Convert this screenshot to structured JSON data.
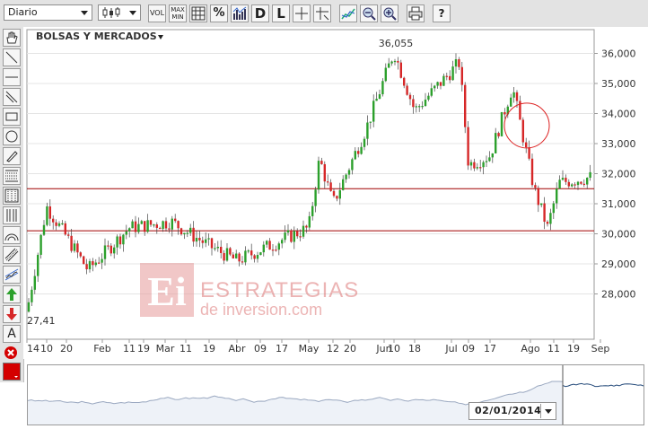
{
  "toolbar": {
    "period_select": "Diario",
    "chart_type_select": "candlestick",
    "buttons": {
      "vol": "VOL",
      "maxmin_top": "MAX",
      "maxmin_bottom": "MIN",
      "percent": "%",
      "daily": "D",
      "log": "L"
    },
    "icons": [
      "vol-icon",
      "maxmin-icon",
      "grid-icon",
      "percent-icon",
      "bar-volume-icon",
      "daily-icon",
      "log-icon",
      "crosshair-icon",
      "crosshair-cross-icon",
      "compare-icon",
      "zoom-out-icon",
      "zoom-in-icon",
      "print-icon",
      "help-icon"
    ]
  },
  "left_tools": {
    "icons": [
      "hand-icon",
      "line-icon",
      "horizontal-line-icon",
      "trendline-icon",
      "rectangle-icon",
      "circle-icon",
      "pencil-icon",
      "fibonacci-icon",
      "fibonacci-fan-icon",
      "vertical-lines-icon",
      "arc-icon",
      "parallel-channel-icon",
      "regression-icon",
      "buy-arrow-icon",
      "sell-arrow-icon",
      "text-icon",
      "delete-icon",
      "color-picker-icon"
    ],
    "text_tool_label": "A",
    "color": "#d40000"
  },
  "chart": {
    "title": "BOLSAS Y MERCADOS",
    "max_label": "36,055",
    "min_label": "27,41",
    "watermark_brand": "Ei",
    "watermark_line1": "ESTRATEGIAS",
    "watermark_line2": "de inversion.com",
    "colors": {
      "up": "#2ca02c",
      "down": "#d62728",
      "support": "#a00000"
    },
    "support_levels": [
      31500,
      30100
    ],
    "circle_annotation": {
      "x": "Jul 30",
      "y": 33600
    }
  },
  "chart_data": {
    "type": "candlestick",
    "y_axis_ticks": [
      "36,000",
      "35,000",
      "34,000",
      "33,000",
      "32,000",
      "31,000",
      "30,000",
      "29,000",
      "28,000"
    ],
    "ylim": [
      27000,
      36500
    ],
    "x_axis_labels": [
      "14",
      "10",
      "20",
      "Feb",
      "11",
      "19",
      "Mar",
      "11",
      "19",
      "Abr",
      "09",
      "17",
      "May",
      "12",
      "20",
      "Jun",
      "10",
      "18",
      "Jul",
      "09",
      "17",
      "Ago",
      "11",
      "19",
      "Sep"
    ],
    "points": [
      {
        "x": "Ene 14",
        "close": 27410
      },
      {
        "x": "Ene 20",
        "close": 30900
      },
      {
        "x": "Feb",
        "close": 28800
      },
      {
        "x": "Feb 19",
        "close": 30200
      },
      {
        "x": "Mar",
        "close": 30400
      },
      {
        "x": "Mar 19",
        "close": 29600
      },
      {
        "x": "Abr",
        "close": 29100
      },
      {
        "x": "Abr 17",
        "close": 29800
      },
      {
        "x": "May",
        "close": 30200
      },
      {
        "x": "May 12",
        "close": 32500
      },
      {
        "x": "May 20",
        "close": 31000
      },
      {
        "x": "Jun",
        "close": 33500
      },
      {
        "x": "Jun 10",
        "close": 36055
      },
      {
        "x": "Jun 18",
        "close": 34100
      },
      {
        "x": "Jul",
        "close": 35700
      },
      {
        "x": "Jul 09",
        "close": 32300
      },
      {
        "x": "Jul 17",
        "close": 32600
      },
      {
        "x": "Jul 30",
        "close": 34900
      },
      {
        "x": "Ago",
        "close": 31500
      },
      {
        "x": "Ago 11",
        "close": 30200
      },
      {
        "x": "Ago 19",
        "close": 31700
      },
      {
        "x": "Sep",
        "close": 31900
      }
    ]
  },
  "navigator": {
    "date": "02/01/2014"
  }
}
